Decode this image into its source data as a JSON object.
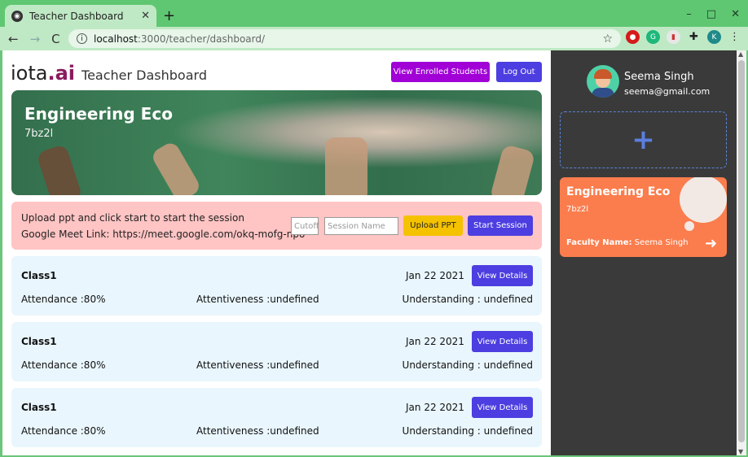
{
  "browser": {
    "tab_title": "Teacher Dashboard",
    "url_host": "localhost",
    "url_path": ":3000/teacher/dashboard/",
    "profile_initial": "K"
  },
  "header": {
    "logo_main": "iota",
    "logo_dot": ".",
    "logo_ai": "ai",
    "subtitle": "Teacher Dashboard",
    "enrolled_label": "View Enrolled Students",
    "logout_label": "Log Out"
  },
  "banner": {
    "title": "Engineering Eco",
    "code": "7bz2l"
  },
  "session": {
    "instruction": "Upload ppt and click start to start the session",
    "meet_label": "Google Meet Link: https://meet.google.com/okq-mofg-npo",
    "cutoff_placeholder": "Cutoff",
    "session_placeholder": "Session Name",
    "upload_label": "Upload PPT",
    "start_label": "Start Session"
  },
  "classes": [
    {
      "name": "Class1",
      "date": "Jan 22 2021",
      "details_label": "View Details",
      "attendance": "Attendance :80%",
      "attentiveness": "Attentiveness :undefined",
      "understanding": "Understanding : undefined"
    },
    {
      "name": "Class1",
      "date": "Jan 22 2021",
      "details_label": "View Details",
      "attendance": "Attendance :80%",
      "attentiveness": "Attentiveness :undefined",
      "understanding": "Understanding : undefined"
    },
    {
      "name": "Class1",
      "date": "Jan 22 2021",
      "details_label": "View Details",
      "attendance": "Attendance :80%",
      "attentiveness": "Attentiveness :undefined",
      "understanding": "Understanding : undefined"
    }
  ],
  "sidebar": {
    "user_name": "Seema Singh",
    "user_email": "seema@gmail.com",
    "add_symbol": "+",
    "course_title": "Engineering Eco",
    "course_code": "7bz2l",
    "faculty_label": "Faculty Name:",
    "faculty_name": " Seema Singh"
  },
  "colors": {
    "enrolled_button": "#a100d6",
    "primary_button": "#4c3ee0",
    "upload_button": "#f5c200",
    "session_bg": "#ffc4c4",
    "card_bg": "#e9f6fd",
    "course_card": "#fb7d4d",
    "sidebar_bg": "#3a3a3a"
  }
}
